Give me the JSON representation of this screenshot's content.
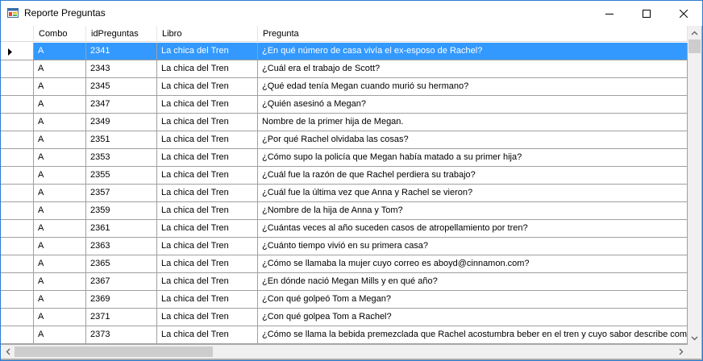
{
  "window": {
    "title": "Reporte Preguntas",
    "icon": "app-form-icon",
    "controls": {
      "minimize": "minimize-icon",
      "maximize": "maximize-icon",
      "close": "close-icon"
    }
  },
  "grid": {
    "columns": [
      "Combo",
      "idPreguntas",
      "Libro",
      "Pregunta"
    ],
    "selected_row": 0,
    "current_row_marker": "triangle-right-icon",
    "rows": [
      [
        "A",
        "2341",
        "La chica del Tren",
        "¿En qué número de casa vivía el ex-esposo de Rachel?"
      ],
      [
        "A",
        "2343",
        "La chica del Tren",
        "¿Cuál era el trabajo de Scott?"
      ],
      [
        "A",
        "2345",
        "La chica del Tren",
        "¿Qué edad tenía Megan cuando murió su hermano?"
      ],
      [
        "A",
        "2347",
        "La chica del Tren",
        "¿Quién asesinó a Megan?"
      ],
      [
        "A",
        "2349",
        "La chica del Tren",
        "Nombre de la primer hija de Megan."
      ],
      [
        "A",
        "2351",
        "La chica del Tren",
        "¿Por qué  Rachel olvidaba las cosas?"
      ],
      [
        "A",
        "2353",
        "La chica del Tren",
        "¿Cómo supo la policía que Megan había matado a su primer hija?"
      ],
      [
        "A",
        "2355",
        "La chica del Tren",
        "¿Cuál fue la razón de que Rachel perdiera su trabajo?"
      ],
      [
        "A",
        "2357",
        "La chica del Tren",
        "¿Cuál fue la última vez que Anna y Rachel se vieron?"
      ],
      [
        "A",
        "2359",
        "La chica del Tren",
        "¿Nombre de la hija de Anna y Tom?"
      ],
      [
        "A",
        "2361",
        "La chica del Tren",
        "¿Cuántas veces al año suceden casos de atropellamiento por tren?"
      ],
      [
        "A",
        "2363",
        "La chica del Tren",
        "¿Cuánto tiempo vivió en su primera casa?"
      ],
      [
        "A",
        "2365",
        "La chica del Tren",
        "¿Cómo se llamaba la mujer cuyo correo es aboyd@cinnamon.com?"
      ],
      [
        "A",
        "2367",
        "La chica del Tren",
        "¿En dónde nació Megan Mills y en qué año?"
      ],
      [
        "A",
        "2369",
        "La chica del Tren",
        "¿Con qué golpeó Tom a Megan?"
      ],
      [
        "A",
        "2371",
        "La chica del Tren",
        "¿Con qué golpea Tom a Rachel?"
      ],
      [
        "A",
        "2373",
        "La chica del Tren",
        "¿Cómo se llama la bebida premezclada que Rachel acostumbra beber en el tren y cuyo sabor describe como am"
      ]
    ]
  },
  "colors": {
    "selection": "#3399ff",
    "gridline": "#a0a0a0",
    "window_border": "#2b7bd1"
  }
}
